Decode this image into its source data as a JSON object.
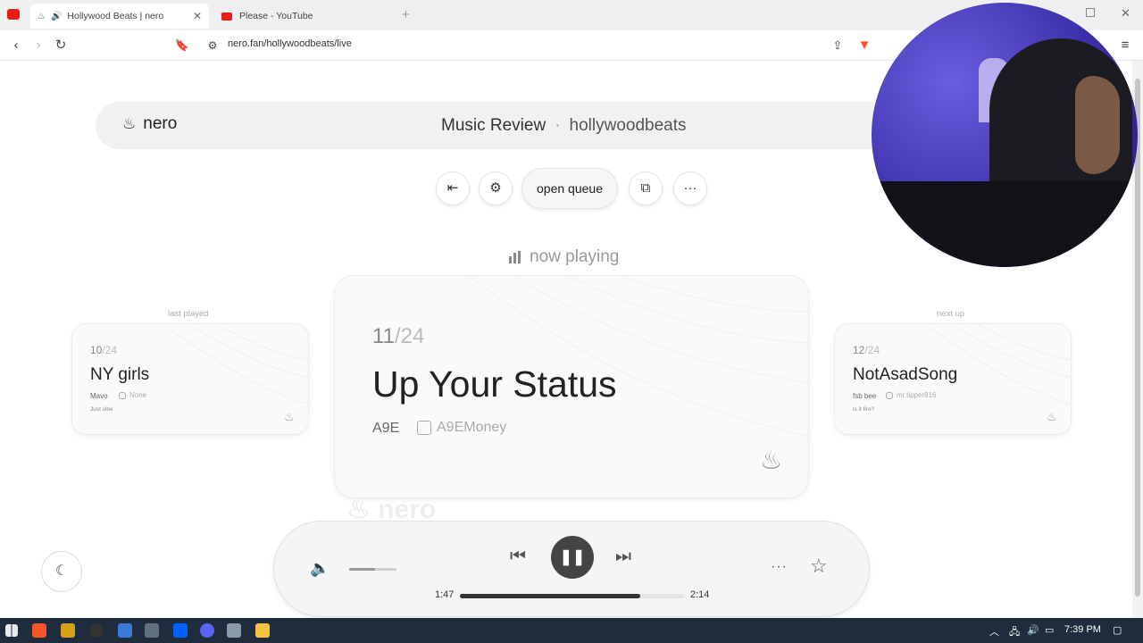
{
  "browser": {
    "tabs": [
      {
        "label": "Hollywood Beats | nero",
        "active": true
      },
      {
        "label": "Please - YouTube",
        "active": false
      }
    ],
    "url": "nero.fan/hollywoodbeats/live"
  },
  "header": {
    "logo": "nero",
    "title": "Music Review",
    "separator": "·",
    "channel": "hollywoodbeats"
  },
  "controls": {
    "queue_label": "open queue"
  },
  "now_playing_label": "now playing",
  "last_played": {
    "caption": "last played",
    "position": "10",
    "total": "/24",
    "title": "NY girls",
    "artist": "Mavo",
    "instagram": "None",
    "note": "Just vibe"
  },
  "current": {
    "position": "11",
    "total": "/24",
    "title": "Up Your Status",
    "artist": "A9E",
    "instagram": "A9EMoney"
  },
  "next_up": {
    "caption": "next up",
    "position": "12",
    "total": "/24",
    "title": "NotAsadSong",
    "artist": "fsb bee",
    "instagram": "mr.tipper816",
    "note": "is it fire?"
  },
  "watermark": "nero",
  "player": {
    "elapsed": "1:47",
    "duration": "2:14",
    "progress": 0.8,
    "volume": 0.55
  },
  "taskbar": {
    "time": "7:39 PM"
  },
  "colors": {
    "youtube_red": "#e62117",
    "taskbar": "#1e2c3d"
  }
}
